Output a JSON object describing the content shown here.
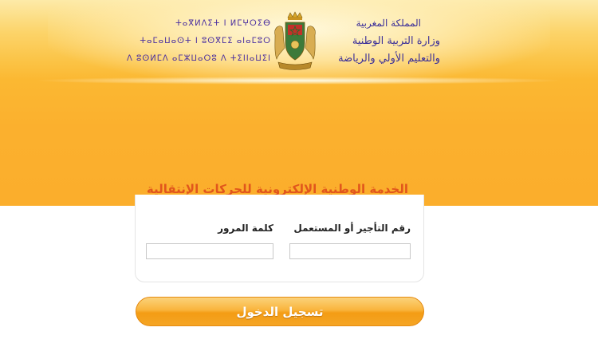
{
  "header": {
    "tifinagh_lines": [
      "ⵜⴰⴳⵍⴷⵉⵜ ⵏ ⵍⵎⵖⵔⵉⴱ",
      "ⵜⴰⵎⴰⵡⴰⵙⵜ ⵏ ⵓⵙⴳⵎⵉ ⴰⵏⴰⵎⵓⵔ",
      "ⴷ ⵓⵙⵍⵎⴷ ⴰⵎⵣⵡⴰⵔⵓ ⴷ ⵜⵉⵏⵏⴰⵡⵉⵏ"
    ],
    "arabic_lines": [
      "المملكة المغربية",
      "وزارة التربية الوطنية",
      "والتعليم الأولي والرياضة"
    ]
  },
  "service_title": "الخدمة الوطنية الإلكترونية للحركات الإنتقالية",
  "login": {
    "user_label": "رقم التأجير أو المستعمل",
    "password_label": "كلمة المرور",
    "user_value": "",
    "password_value": "",
    "submit_label": "تسجيل الدخول"
  },
  "colors": {
    "band": "#fbae2c",
    "title": "#e1561c",
    "ministry_text": "#3b2f99",
    "button": "#f5a524"
  },
  "icons": [
    "royal-emblem-icon"
  ]
}
